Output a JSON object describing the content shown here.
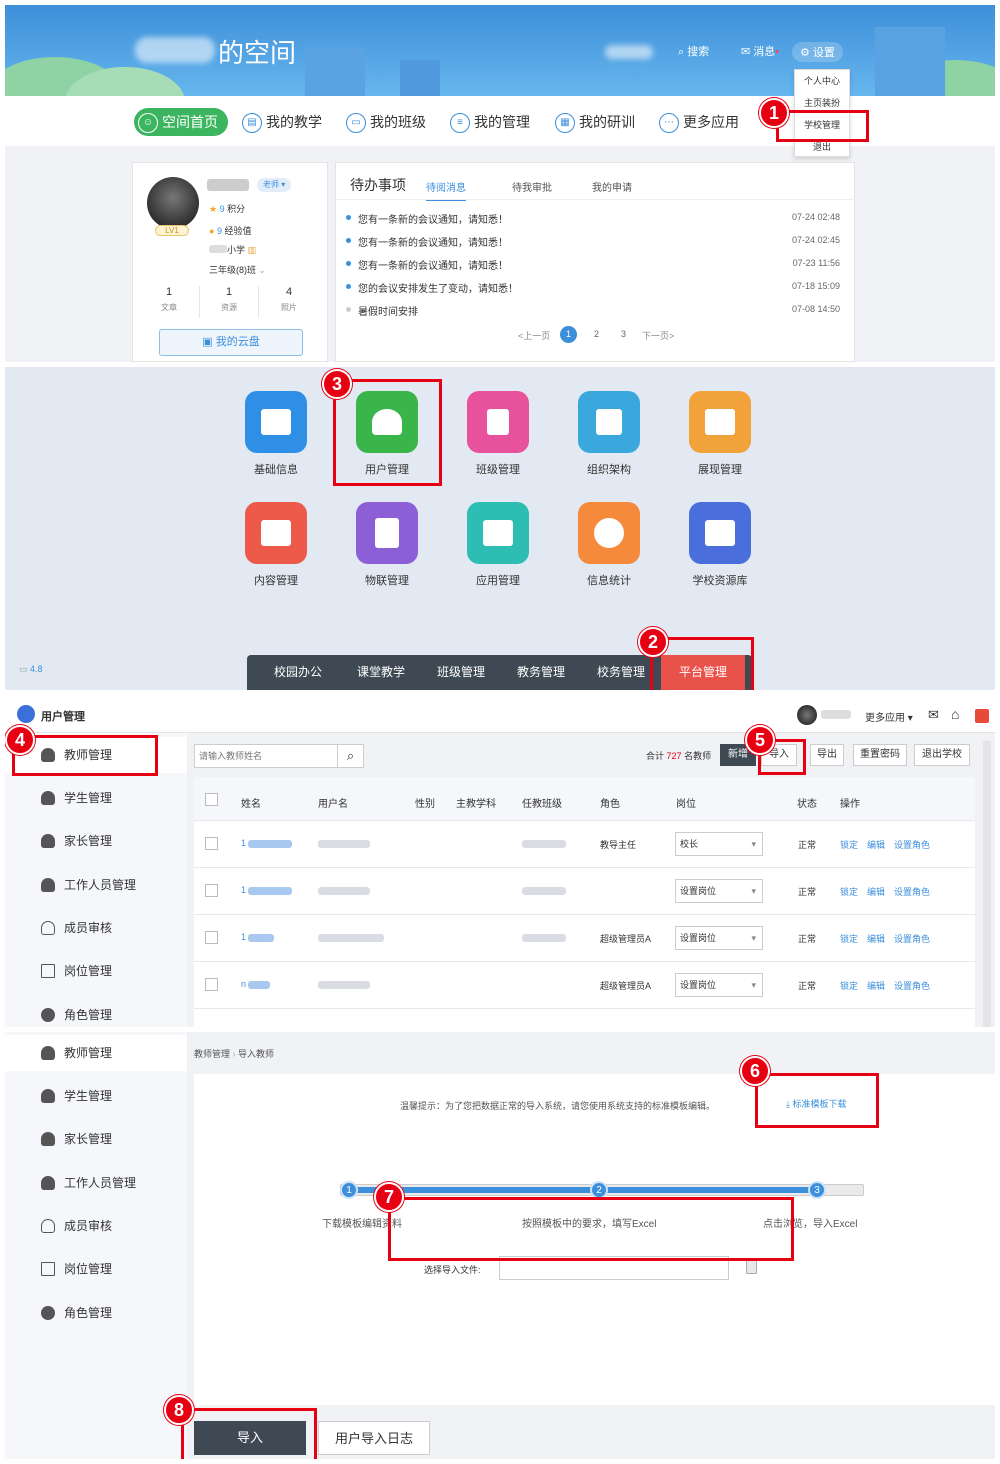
{
  "panel1": {
    "banner_title": "的空间",
    "topnav": {
      "search": "搜索",
      "message": "消息",
      "settings": "设置"
    },
    "dropdown": [
      "个人中心",
      "主页装扮",
      "学校管理",
      "退出"
    ],
    "nav": [
      "空间首页",
      "我的教学",
      "我的班级",
      "我的管理",
      "我的研训",
      "更多应用"
    ],
    "profile": {
      "role_badge": "老师 ▾",
      "level": "LV1",
      "points_value": "9",
      "points_label": "积分",
      "exp_value": "9",
      "exp_label": "经验值",
      "school": "小学",
      "class_name": "三年级(8)班",
      "stats": [
        {
          "value": "1",
          "label": "文章"
        },
        {
          "value": "1",
          "label": "资源"
        },
        {
          "value": "4",
          "label": "照片"
        }
      ],
      "cloud_button": "我的云盘"
    },
    "todo": {
      "title": "待办事项",
      "tabs": [
        "待阅消息",
        "待我审批",
        "我的申请"
      ],
      "messages": [
        {
          "text": "您有一条新的会议通知，请知悉！",
          "time": "07-24 02:48"
        },
        {
          "text": "您有一条新的会议通知，请知悉！",
          "time": "07-24 02:45"
        },
        {
          "text": "您有一条新的会议通知，请知悉！",
          "time": "07-23 11:56"
        },
        {
          "text": "您的会议安排发生了变动，请知悉！",
          "time": "07-18 15:09"
        },
        {
          "text": "暑假时间安排",
          "time": "07-08 14:50"
        }
      ],
      "pager": {
        "prev": "<上一页",
        "pages": [
          "1",
          "2",
          "3"
        ],
        "next": "下一页>"
      }
    }
  },
  "panel2": {
    "apps": [
      {
        "label": "基础信息",
        "color": "#2f8fe6"
      },
      {
        "label": "用户管理",
        "color": "#39b54a"
      },
      {
        "label": "班级管理",
        "color": "#e8519b"
      },
      {
        "label": "组织架构",
        "color": "#3aa8dc"
      },
      {
        "label": "展现管理",
        "color": "#f2a23a"
      },
      {
        "label": "内容管理",
        "color": "#ee5a4a"
      },
      {
        "label": "物联管理",
        "color": "#8c5fd6"
      },
      {
        "label": "应用管理",
        "color": "#2ebdb3"
      },
      {
        "label": "信息统计",
        "color": "#f58a3c"
      },
      {
        "label": "学校资源库",
        "color": "#4a6fdc"
      }
    ],
    "version": "4.8",
    "tabs": [
      "校园办公",
      "课堂教学",
      "班级管理",
      "教务管理",
      "校务管理",
      "平台管理"
    ]
  },
  "panel3": {
    "title": "用户管理",
    "more_apps": "更多应用 ▾",
    "sidebar": [
      "教师管理",
      "学生管理",
      "家长管理",
      "工作人员管理",
      "成员审核",
      "岗位管理",
      "角色管理"
    ],
    "search_placeholder": "请输入教师姓名",
    "count_prefix": "合计",
    "count_value": "727",
    "count_suffix": "名教师",
    "buttons": [
      "新增",
      "导入",
      "导出",
      "重置密码",
      "退出学校"
    ],
    "columns": [
      "姓名",
      "用户名",
      "性别",
      "主教学科",
      "任教班级",
      "角色",
      "岗位",
      "状态",
      "操作"
    ],
    "rows": [
      {
        "name": "1",
        "role": "教导主任",
        "post": "校长",
        "status": "正常"
      },
      {
        "name": "1",
        "role": "",
        "post": "设置岗位",
        "status": "正常"
      },
      {
        "name": "1",
        "role": "超级管理员A",
        "post": "设置岗位",
        "status": "正常"
      },
      {
        "name": "n",
        "role": "超级管理员A",
        "post": "设置岗位",
        "status": "正常"
      }
    ],
    "actions": [
      "锁定",
      "编辑",
      "设置角色"
    ]
  },
  "panel4": {
    "breadcrumb": [
      "教师管理",
      "导入教师"
    ],
    "tip": "温馨提示：为了您把数据正常的导入系统，请您使用系统支持的标准模板编辑。",
    "template_link": "标准模板下载",
    "steps": [
      {
        "n": "1",
        "label": "下载模板编辑资料"
      },
      {
        "n": "2",
        "label": "按照模板中的要求，填写Excel"
      },
      {
        "n": "3",
        "label": "点击浏览，导入Excel"
      }
    ],
    "file_label": "选择导入文件:",
    "import_button": "导入",
    "log_button": "用户导入日志"
  },
  "annotations": [
    "1",
    "2",
    "3",
    "4",
    "5",
    "6",
    "7",
    "8"
  ],
  "colors": {
    "accent": "#3c8fdb",
    "highlight": "#e60012",
    "nav_active": "#3bb55f",
    "dark_bar": "#3e4954",
    "tab_active": "#e8524a"
  }
}
